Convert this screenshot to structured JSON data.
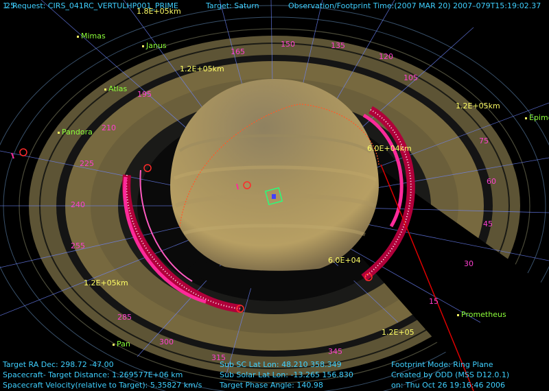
{
  "header": {
    "request": "1. Request: CIRS_041RC_VERTULHP001_PRIME",
    "target": "Target: Saturn",
    "time": "Observation/Footprint Time:(2007 MAR 20) 2007–079T15:19:02.37",
    "corner_number": "25"
  },
  "moons": [
    "Mimas",
    "Janus",
    "Atlas",
    "Pandora",
    "Epime",
    "Prometheus",
    "Pan"
  ],
  "ring_labels": [
    "165",
    "150",
    "135",
    "120",
    "105",
    "195",
    "210",
    "225",
    "240",
    "255",
    "75",
    "60",
    "45",
    "30",
    "15",
    "345",
    "315",
    "300",
    "285"
  ],
  "distance_labels": [
    "1.8E+05km",
    "1.2E+05km",
    "1.2E+05km",
    "6.0E+04km",
    "1.2E+05km",
    "6.0E+04",
    "1.2E+05"
  ],
  "footer": {
    "ra_dec": "Target RA Dec: 298.72   -47.00",
    "distance": "Spacecraft- Target Distance: 1.269577E+06 km",
    "velocity": "Spacecraft Velocity(relative to Target): 5.35827 km/s",
    "sub_sc": "Sub SC Lat Lon: 48.210  358.349",
    "sub_solar": "Sub Solar Lat Lon: -13.265  156.830",
    "phase": "Target Phase Angle: 140.98",
    "mode": "Footprint Mode: Ring Plane",
    "created": "Created by ODD (MSS D12.0.1)",
    "on": "on: Thu Oct 26 19:16:46 2006"
  },
  "colors": {
    "hud": "#3fd0ff",
    "moon": "#8cff3a",
    "ring_label": "#ff3fd0",
    "distance": "#ffff66",
    "track": "#ff2a8a",
    "grid": "#6f86ff"
  }
}
